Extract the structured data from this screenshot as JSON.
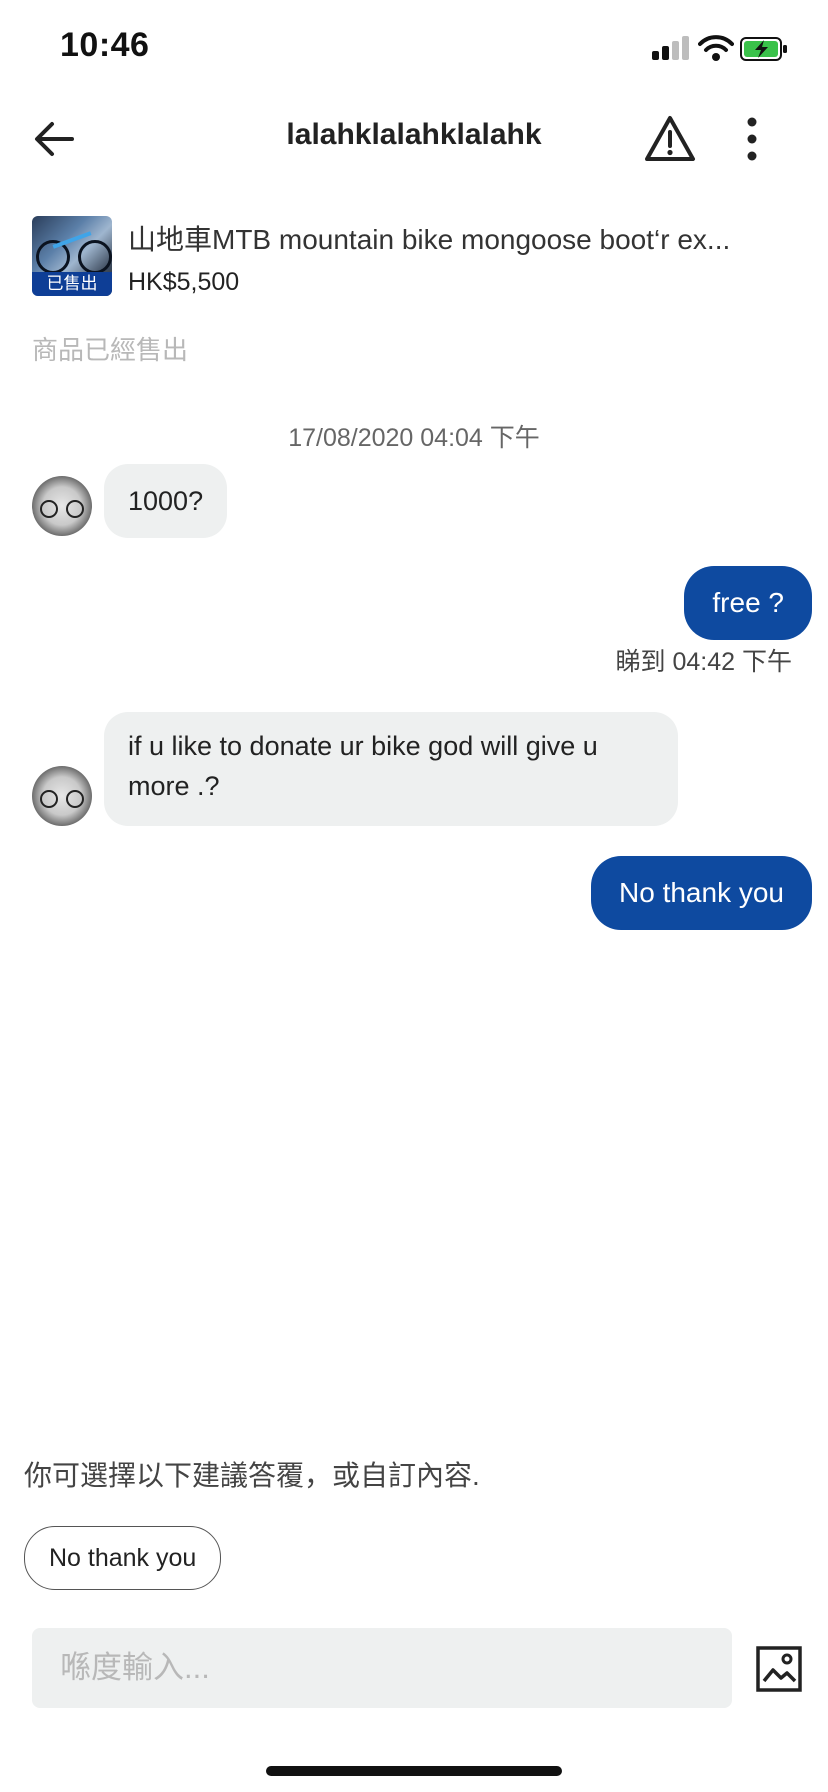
{
  "status_bar": {
    "time": "10:46"
  },
  "header": {
    "title": "lalahklalahklalahk"
  },
  "product": {
    "name": "山地車MTB mountain bike mongoose boot‘r ex...",
    "price": "HK$5,500",
    "sold_badge": "已售出",
    "sold_notice": "商品已經售出"
  },
  "chat": {
    "date": "17/08/2020 04:04 下午",
    "messages": [
      {
        "from": "other",
        "text": "1000?"
      },
      {
        "from": "me",
        "text": "free ?"
      },
      {
        "from": "other",
        "text": "if u like to donate ur bike god will give u more .?"
      },
      {
        "from": "me",
        "text": "No thank you"
      }
    ],
    "seen": "睇到 04:42 下午"
  },
  "suggestions": {
    "hint": "你可選擇以下建議答覆，或自訂內容.",
    "chips": [
      "No thank you"
    ]
  },
  "composer": {
    "placeholder": "喺度輸入..."
  },
  "colors": {
    "accent": "#0e4aa0",
    "bubble_in": "#eef0f0",
    "sold_badge": "#0e3e96"
  }
}
